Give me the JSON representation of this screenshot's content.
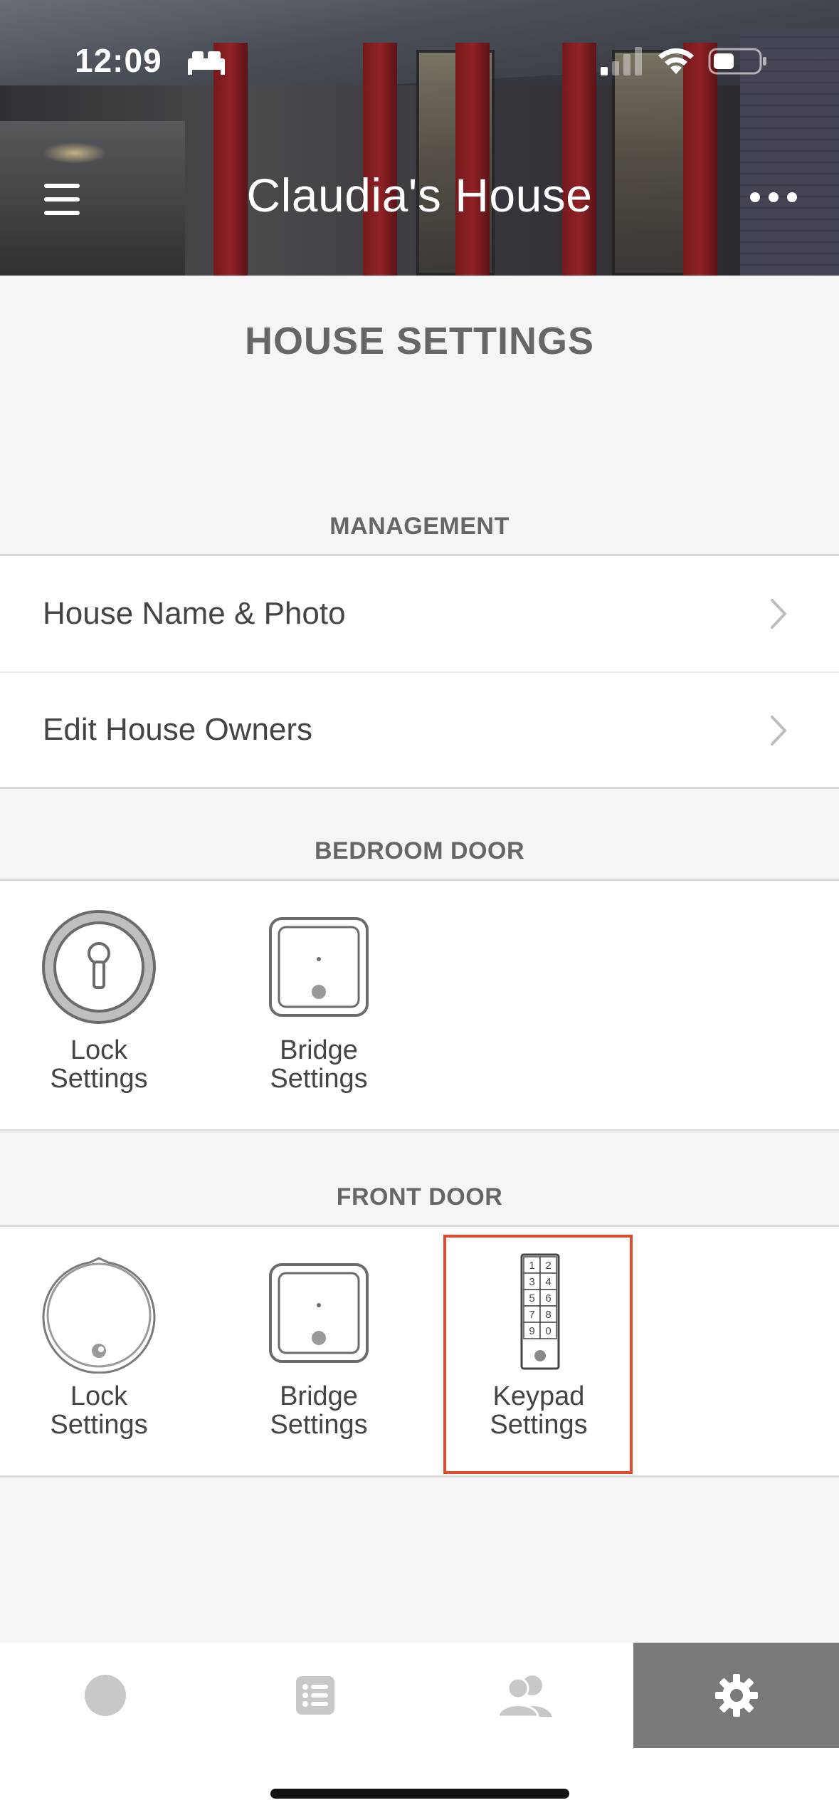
{
  "status_bar": {
    "time": "12:09"
  },
  "header": {
    "title": "Claudia's House"
  },
  "page": {
    "title": "HOUSE SETTINGS"
  },
  "management": {
    "header": "MANAGEMENT",
    "items": [
      {
        "label": "House Name & Photo"
      },
      {
        "label": "Edit House Owners"
      }
    ]
  },
  "bedroom_door": {
    "header": "BEDROOM DOOR",
    "devices": [
      {
        "line1": "Lock",
        "line2": "Settings",
        "icon": "lock-icon"
      },
      {
        "line1": "Bridge",
        "line2": "Settings",
        "icon": "bridge-icon"
      }
    ]
  },
  "front_door": {
    "header": "FRONT DOOR",
    "devices": [
      {
        "line1": "Lock",
        "line2": "Settings",
        "icon": "smart-lock-icon"
      },
      {
        "line1": "Bridge",
        "line2": "Settings",
        "icon": "bridge-icon"
      },
      {
        "line1": "Keypad",
        "line2": "Settings",
        "icon": "keypad-icon"
      }
    ],
    "highlight_color": "#e04a2f"
  },
  "keypad_keys": [
    "1",
    "2",
    "3",
    "4",
    "5",
    "6",
    "7",
    "8",
    "9",
    "0"
  ],
  "tabbar": {
    "tabs": [
      {
        "icon": "lock-status-icon"
      },
      {
        "icon": "activity-list-icon"
      },
      {
        "icon": "guests-icon"
      },
      {
        "icon": "settings-gear-icon",
        "active": true
      }
    ],
    "active_color": "#7a7a7a"
  }
}
